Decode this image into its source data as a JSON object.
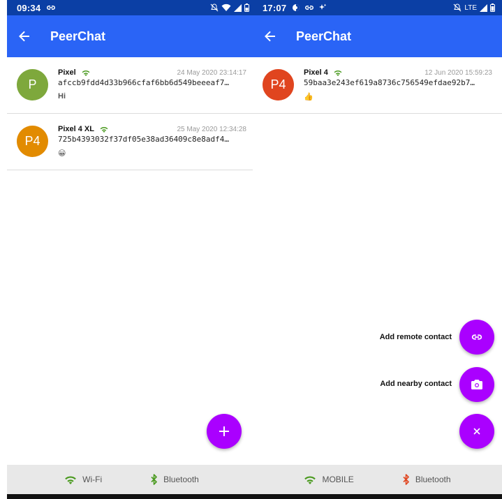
{
  "app_title": "PeerChat",
  "left": {
    "status": {
      "time": "09:34"
    },
    "contacts": [
      {
        "initials": "P",
        "avatar_color": "#7ea83c",
        "name": "Pixel",
        "time": "24 May 2020 23:14:17",
        "id": "afccb9fdd4d33b966cfaf6bb6d549beeeaf7…",
        "message": "Hi"
      },
      {
        "initials": "P4",
        "avatar_color": "#e28b00",
        "name": "Pixel 4 XL",
        "time": "25 May 2020 12:34:28",
        "id": "725b4393032f37df05e38ad36409c8e8adf4…",
        "message": "😀"
      }
    ],
    "fab_icon": "plus-icon",
    "bottom": {
      "net_label": "Wi-Fi",
      "bt_label": "Bluetooth"
    }
  },
  "right": {
    "status": {
      "time": "17:07",
      "net_label": "LTE"
    },
    "contacts": [
      {
        "initials": "P4",
        "avatar_color": "#e0451f",
        "name": "Pixel 4",
        "time": "12 Jun 2020 15:59:23",
        "id": "59baa3e243ef619a8736c756549efdae92b7…",
        "message": "👍"
      }
    ],
    "fab_menu": {
      "remote_label": "Add remote contact",
      "nearby_label": "Add nearby contact"
    },
    "bottom": {
      "net_label": "MOBILE",
      "bt_label": "Bluetooth"
    }
  },
  "colors": {
    "status_bar": "#0b3fa5",
    "app_bar": "#2a64f6",
    "fab": "#aa00ff",
    "wifi_green": "#4a9a1f",
    "bluetooth_active": "#e0451f"
  }
}
